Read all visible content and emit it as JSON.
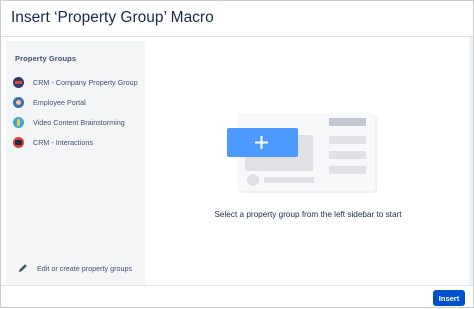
{
  "dialog": {
    "title": "Insert ‘Property Group’ Macro"
  },
  "sidebar": {
    "heading": "Property Groups",
    "items": [
      {
        "label": "CRM - Company Property Group",
        "icon": "crm-group-icon"
      },
      {
        "label": "Employee Portal",
        "icon": "employee-portal-icon"
      },
      {
        "label": "Video Content Brainstorming",
        "icon": "video-content-icon"
      },
      {
        "label": "CRM - Interactions",
        "icon": "crm-interactions-icon"
      }
    ],
    "edit_label": "Edit or create property groups",
    "edit_icon": "pencil-icon"
  },
  "main": {
    "prompt": "Select a property group from the left sidebar to start",
    "illustration_icon": "plus-icon"
  },
  "footer": {
    "insert_label": "Insert"
  },
  "colors": {
    "primary": "#0052cc",
    "illustration_blue": "#4c9aff",
    "sidebar_bg": "#f4f5f7",
    "text": "#172b4d"
  }
}
